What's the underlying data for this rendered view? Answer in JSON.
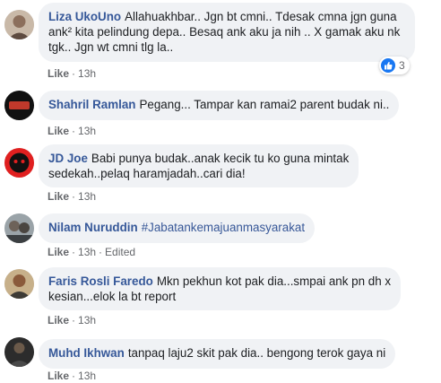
{
  "comments": [
    {
      "author": "Liza UkoUno",
      "lines": [
        "Allahuakhbar.. Jgn bt cmni.. Tdesak cmna jgn guna",
        "ank² kita pelindung depa.. Besaq ank aku ja nih .. X gamak aku nk",
        "tgk.. Jgn wt cmni tlg la.."
      ],
      "like": "Like",
      "time": "13h",
      "reaction_count": "3"
    },
    {
      "author": "Shahril Ramlan",
      "text": "Pegang... Tampar kan ramai2 parent budak ni..",
      "like": "Like",
      "time": "13h"
    },
    {
      "author": "JD Joe",
      "lines": [
        "Babi punya budak..anak kecik tu ko guna mintak",
        "sedekah..pelaq haramjadah..cari dia!"
      ],
      "like": "Like",
      "time": "13h"
    },
    {
      "author": "Nilam Nuruddin",
      "tag": "#Jabatankemajuanmasyarakat",
      "like": "Like",
      "time": "13h",
      "edited": "Edited"
    },
    {
      "author": "Faris Rosli Faredo",
      "lines": [
        "Mkn pekhun kot pak dia...smpai ank pn dh x",
        "kesian...elok la bt report"
      ],
      "like": "Like",
      "time": "13h"
    },
    {
      "author": "Muhd Ikhwan",
      "text": "tanpaq laju2 skit pak dia.. bengong terok gaya ni",
      "like": "Like",
      "time": "13h"
    }
  ],
  "icons": {
    "reaction": "like-thumb-icon"
  },
  "colors": {
    "author": "#365899",
    "bubble": "#f0f2f5",
    "like_badge": "#1877f2",
    "meta": "#65676b"
  }
}
